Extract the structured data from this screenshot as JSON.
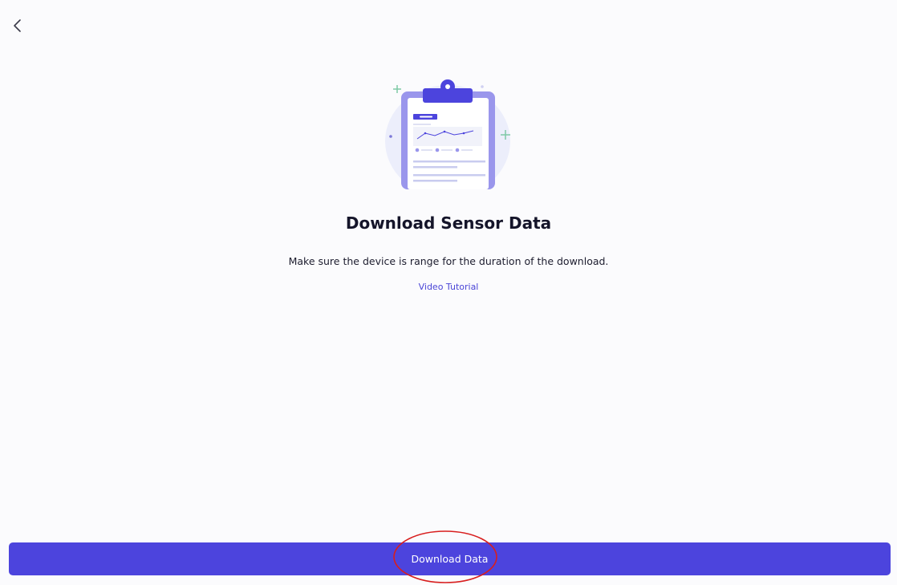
{
  "header": {
    "back_icon": "chevron-left-icon"
  },
  "illustration": {
    "name": "clipboard-chart-illustration",
    "accent_color": "#4c44dd",
    "bg_color": "#e8e9fb"
  },
  "content": {
    "title": "Download Sensor Data",
    "description": "Make sure the device is range for the duration of the download.",
    "tutorial_link": "Video Tutorial"
  },
  "footer": {
    "download_label": "Download Data",
    "button_color": "#4c44dd",
    "highlight_color": "#d81e1e"
  }
}
